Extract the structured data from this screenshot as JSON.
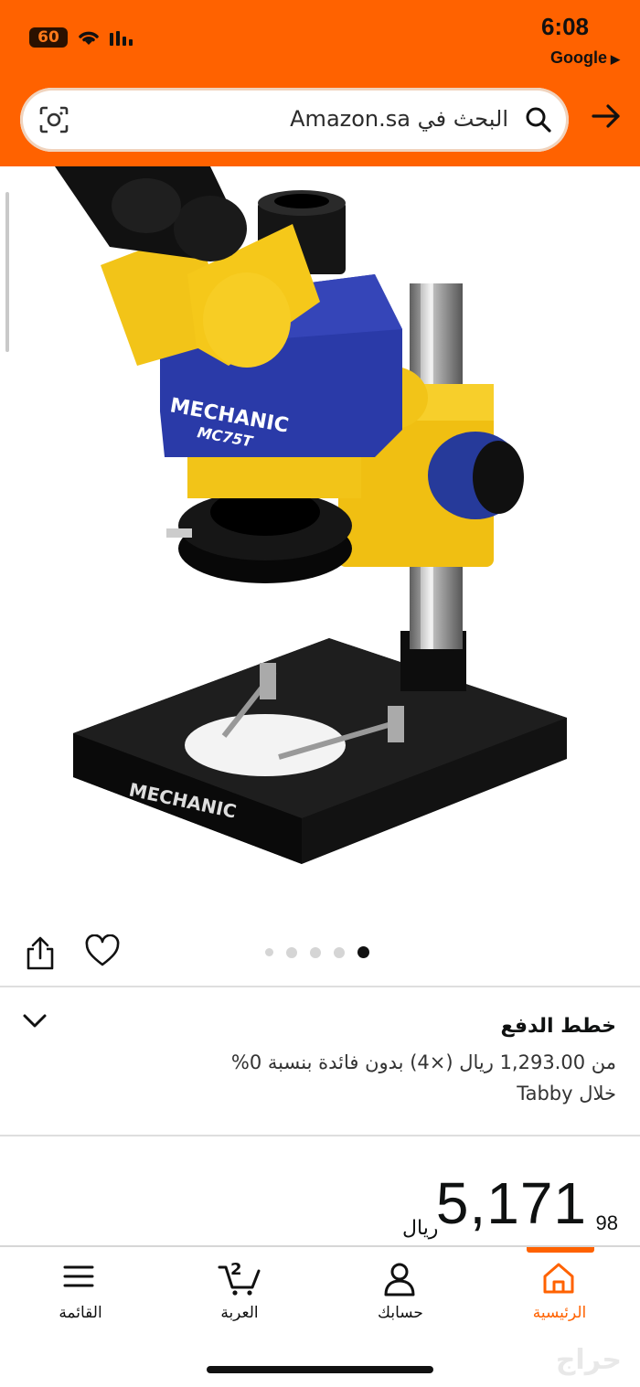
{
  "status_bar": {
    "battery": "60",
    "time": "6:08",
    "carrier": "Google",
    "carrier_arrow": "▶"
  },
  "search": {
    "placeholder": "البحث في Amazon.sa",
    "camera_icon": "camera-icon",
    "search_icon": "search-icon",
    "back_icon": "arrow-right-icon"
  },
  "product": {
    "image_brand": "MECHANIC",
    "image_model": "MC75T",
    "gallery_count": 5,
    "gallery_active_index": 4
  },
  "payment_plans": {
    "title": "خطط الدفع",
    "line1": "من 1,293.00 ريال (×4) بدون فائدة بنسبة 0%",
    "line2": "خلال Tabby"
  },
  "price": {
    "whole": "5,171",
    "fraction": "98",
    "currency": "ريال"
  },
  "bottom_nav": {
    "items": [
      {
        "label": "القائمة",
        "icon": "menu-icon"
      },
      {
        "label": "العربة",
        "icon": "cart-icon",
        "badge": "2"
      },
      {
        "label": "حسابك",
        "icon": "account-icon"
      },
      {
        "label": "الرئيسية",
        "icon": "home-icon",
        "active": true
      }
    ]
  },
  "watermark": "حراج",
  "colors": {
    "accent": "#ff6200",
    "text": "#0f1111"
  }
}
